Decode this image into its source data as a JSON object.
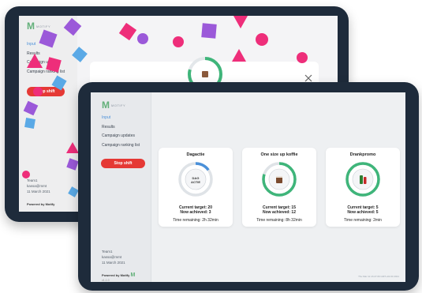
{
  "brand": {
    "logo_mark": "M",
    "logo_text": "MOTIFY",
    "powered_by": "Powered by Motify",
    "version": "v1.1.0"
  },
  "nav": [
    "Input",
    "Results",
    "Campaign updates",
    "Campaign ranking list"
  ],
  "stop_button": "Stop shift",
  "user": {
    "team": "Team1",
    "email": "kassa@mmt",
    "date": "11 March 2021"
  },
  "timestamp": "Thu Mar 11 16:27:06 GMT+01:00 2021",
  "modal": {
    "close_icon": "close-icon"
  },
  "accent_colors": {
    "stop": "#e53935",
    "ring_green": "#3fb57a",
    "ring_blue": "#4a90d9",
    "frame": "#1e2b3b",
    "confetti_pink": "#ee2e7a",
    "confetti_purple": "#9b59d9",
    "confetti_blue": "#5aa9e6"
  },
  "campaigns": [
    {
      "name": "Dagactie",
      "icon_label": "DAG ACTIE",
      "target": "Current target: 20",
      "achieved": "Now achieved: 3",
      "remaining": "Time remaining: 2h 32min",
      "progress": 0.15
    },
    {
      "name": "One size up koffie",
      "icon": "coffee-cup-icon",
      "target": "Current target: 15",
      "achieved": "Now achieved: 12",
      "remaining": "Time remaining: 8h 32min",
      "progress": 0.8
    },
    {
      "name": "Drankpromo",
      "icon": "bottle-icon",
      "target": "Current target: 5",
      "achieved": "Now achieved: 5",
      "remaining": "Time remaining: 2min",
      "progress": 1.0
    }
  ]
}
